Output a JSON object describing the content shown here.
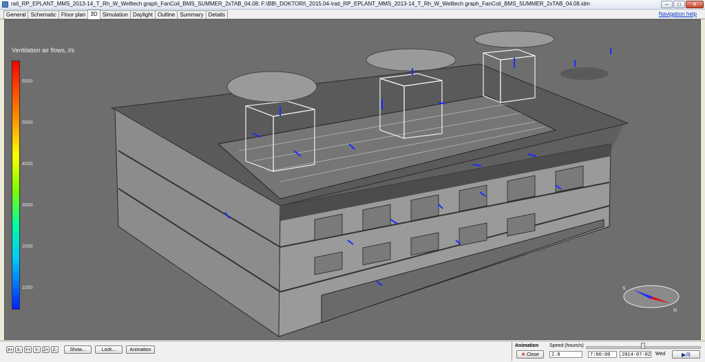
{
  "window": {
    "title": "rati_RP_EPLANT_MMS_2013-14_T_Rh_W_Welltech graph_FanCoil_BMS_SUMMER_2xTAB_04.08: F:\\BB\\_DOKTORI\\_2015.04-\\rati_RP_EPLANT_MMS_2013-14_T_Rh_W_Welltech graph_FanCoil_BMS_SUMMER_2xTAB_04.08.idm",
    "minimize": "–",
    "maximize": "□",
    "close": "✕"
  },
  "tabs": [
    "General",
    "Schematic",
    "Floor plan",
    "3D",
    "Simulation",
    "Daylight",
    "Outline",
    "Summary",
    "Details"
  ],
  "active_tab": "3D",
  "nav_help": "Navigation help",
  "legend": {
    "title": "Ventilation air flows, l/s",
    "ticks": [
      "6000",
      "5000",
      "4000",
      "3000",
      "2000",
      "1000"
    ]
  },
  "compass": {
    "north": "N",
    "south": "S"
  },
  "toolbar": {
    "axis_buttons": [
      "X+",
      "X-",
      "Y+",
      "Y-",
      "Z+",
      "Z-"
    ],
    "show": "Show...",
    "lock": "Lock...",
    "animation": "Animation"
  },
  "animation_panel": {
    "title": "Animation",
    "close": "Close",
    "speed_label": "Speed (hours/s)",
    "speed_value": "2.0",
    "time": "7:00:00",
    "date": "2014-07-02",
    "weekday": "Wed",
    "play_pause": "▶/II"
  },
  "colors": {
    "background": "#6e6e6e",
    "accent": "#0033cc"
  }
}
